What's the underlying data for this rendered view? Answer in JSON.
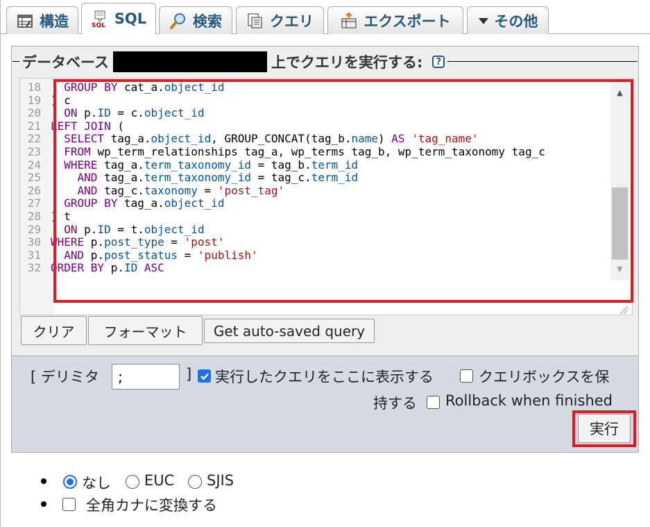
{
  "tabs": [
    {
      "label": "構造",
      "icon": "structure-icon"
    },
    {
      "label": "SQL",
      "icon": "sql-icon"
    },
    {
      "label": "検索",
      "icon": "search-icon"
    },
    {
      "label": "クエリ",
      "icon": "query-icon"
    },
    {
      "label": "エクスポート",
      "icon": "export-icon"
    },
    {
      "label": "その他",
      "icon": "dropdown-arrow-icon"
    }
  ],
  "panel": {
    "legend_prefix": "データベース",
    "legend_suffix": "上でクエリを実行する:",
    "help_icon": "?"
  },
  "editor": {
    "lines": [
      {
        "num": "18",
        "tokens": [
          [
            "kw",
            "  GROUP BY "
          ],
          [
            "fn",
            "cat_a."
          ],
          [
            "prop",
            "object_id"
          ]
        ]
      },
      {
        "num": "19",
        "tokens": [
          [
            "fn",
            ") c"
          ]
        ]
      },
      {
        "num": "20",
        "tokens": [
          [
            "kw",
            "  ON "
          ],
          [
            "fn",
            "p."
          ],
          [
            "prop",
            "ID"
          ],
          [
            "fn",
            " = c."
          ],
          [
            "prop",
            "object_id"
          ]
        ]
      },
      {
        "num": "21",
        "tokens": [
          [
            "kw",
            "LEFT JOIN "
          ],
          [
            "fn",
            "("
          ]
        ]
      },
      {
        "num": "22",
        "tokens": [
          [
            "kw",
            "  SELECT "
          ],
          [
            "fn",
            "tag_a."
          ],
          [
            "prop",
            "object_id"
          ],
          [
            "fn",
            ", GROUP_CONCAT(tag_b."
          ],
          [
            "prop",
            "name"
          ],
          [
            "fn",
            ") "
          ],
          [
            "kw",
            "AS "
          ],
          [
            "str",
            "'tag_name'"
          ]
        ]
      },
      {
        "num": "23",
        "tokens": [
          [
            "kw",
            "  FROM "
          ],
          [
            "fn",
            "wp_term_relationships tag_a, wp_terms tag_b, wp_term_taxonomy tag_c"
          ]
        ]
      },
      {
        "num": "24",
        "tokens": [
          [
            "kw",
            "  WHERE "
          ],
          [
            "fn",
            "tag_a."
          ],
          [
            "prop",
            "term_taxonomy_id"
          ],
          [
            "fn",
            " = tag_b."
          ],
          [
            "prop",
            "term_id"
          ]
        ]
      },
      {
        "num": "25",
        "tokens": [
          [
            "kw",
            "    AND "
          ],
          [
            "fn",
            "tag_a."
          ],
          [
            "prop",
            "term_taxonomy_id"
          ],
          [
            "fn",
            " = tag_c."
          ],
          [
            "prop",
            "term_id"
          ]
        ]
      },
      {
        "num": "26",
        "tokens": [
          [
            "kw",
            "    AND "
          ],
          [
            "fn",
            "tag_c."
          ],
          [
            "prop",
            "taxonomy"
          ],
          [
            "fn",
            " = "
          ],
          [
            "str",
            "'post_tag'"
          ]
        ]
      },
      {
        "num": "27",
        "tokens": [
          [
            "kw",
            "  GROUP BY "
          ],
          [
            "fn",
            "tag_a."
          ],
          [
            "prop",
            "object_id"
          ]
        ]
      },
      {
        "num": "28",
        "tokens": [
          [
            "fn",
            ") t"
          ]
        ]
      },
      {
        "num": "29",
        "tokens": [
          [
            "kw",
            "  ON "
          ],
          [
            "fn",
            "p."
          ],
          [
            "prop",
            "ID"
          ],
          [
            "fn",
            " = t."
          ],
          [
            "prop",
            "object_id"
          ]
        ]
      },
      {
        "num": "30",
        "tokens": [
          [
            "kw",
            "WHERE "
          ],
          [
            "fn",
            "p."
          ],
          [
            "prop",
            "post_type"
          ],
          [
            "fn",
            " = "
          ],
          [
            "str",
            "'post'"
          ]
        ]
      },
      {
        "num": "31",
        "tokens": [
          [
            "kw",
            "  AND "
          ],
          [
            "fn",
            "p."
          ],
          [
            "prop",
            "post_status"
          ],
          [
            "fn",
            " = "
          ],
          [
            "str",
            "'publish'"
          ]
        ]
      },
      {
        "num": "32",
        "tokens": [
          [
            "kw",
            "ORDER BY "
          ],
          [
            "fn",
            "p."
          ],
          [
            "prop",
            "ID"
          ],
          [
            "kw",
            " ASC"
          ]
        ]
      }
    ]
  },
  "buttons": {
    "clear": "クリア",
    "format": "フォーマット",
    "autosave": "Get auto-saved query"
  },
  "options": {
    "delimiter_open": "[ デリミタ",
    "delimiter_value": ";",
    "delimiter_close": "]",
    "show_query_label": "実行したクエリをここに表示する",
    "show_query_checked": true,
    "keep_box_label_1": "クエリボックスを保",
    "keep_box_label_2": "持する",
    "keep_box_checked": false,
    "rollback_label": "Rollback when finished",
    "rollback_checked": false,
    "execute": "実行"
  },
  "charset": {
    "options": [
      {
        "label": "なし",
        "checked": true
      },
      {
        "label": "EUC",
        "checked": false
      },
      {
        "label": "SJIS",
        "checked": false
      }
    ],
    "kana_label": "全角カナに変換する",
    "kana_checked": false
  },
  "colors": {
    "tab_text": "#235a81",
    "highlight": "#e01b24",
    "checkbox_accent": "#1a73e8"
  }
}
